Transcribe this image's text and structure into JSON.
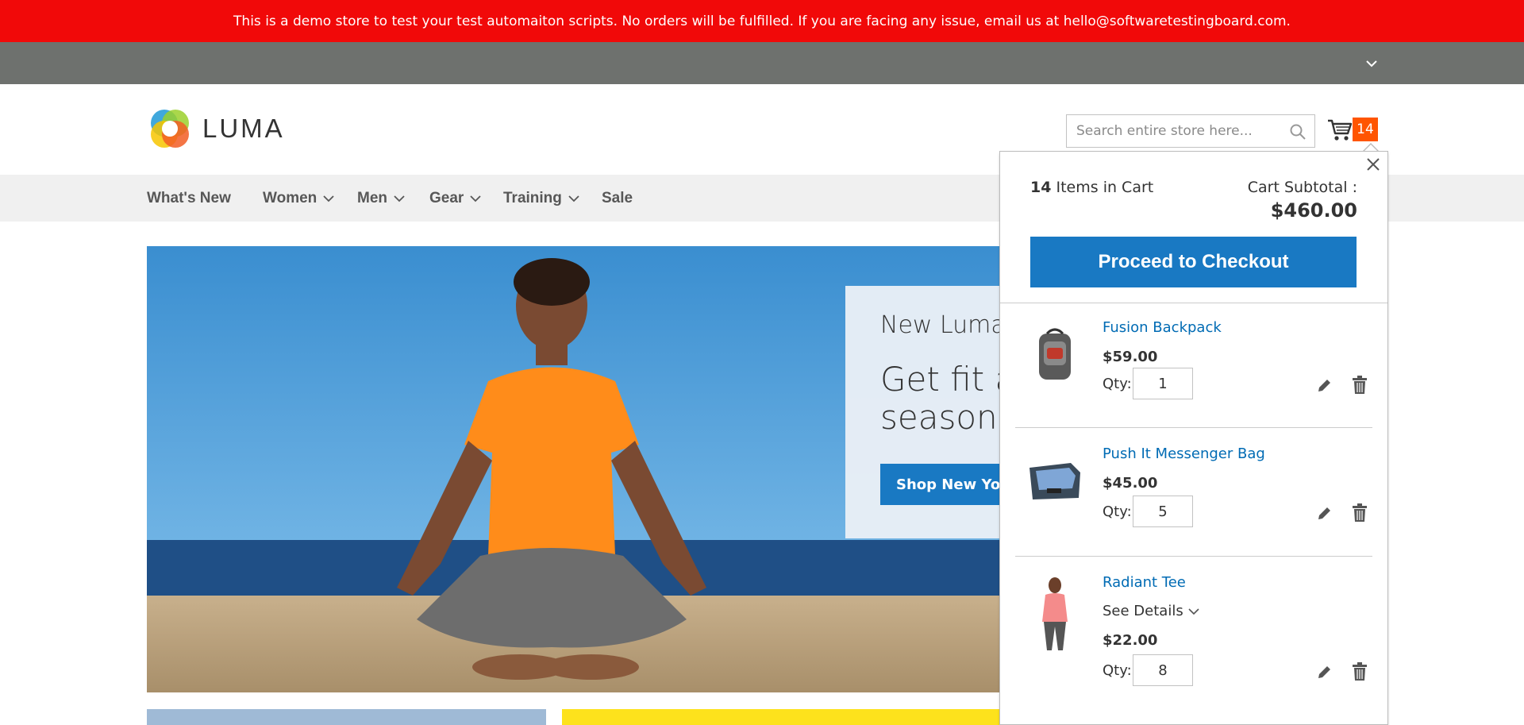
{
  "demo_notice": "This is a demo store to test your test automaiton scripts. No orders will be fulfilled. If you are facing any issue, email us at hello@softwaretestingboard.com.",
  "header": {
    "logo_text": "LUMA",
    "search_placeholder": "Search entire store here...",
    "cart_count": "14"
  },
  "nav": {
    "items": [
      {
        "label": "What's New",
        "has_submenu": false
      },
      {
        "label": "Women",
        "has_submenu": true
      },
      {
        "label": "Men",
        "has_submenu": true
      },
      {
        "label": "Gear",
        "has_submenu": true
      },
      {
        "label": "Training",
        "has_submenu": true
      },
      {
        "label": "Sale",
        "has_submenu": false
      }
    ]
  },
  "hero": {
    "kicker": "New Luma Y",
    "headline_line1": "Get fit ar",
    "headline_line2": "seasona",
    "button_label": "Shop New Yoga"
  },
  "minicart": {
    "count": "14",
    "count_suffix": "Items in Cart",
    "subtotal_label": "Cart Subtotal :",
    "subtotal": "$460.00",
    "checkout_label": "Proceed to Checkout",
    "qty_label": "Qty:",
    "see_details_label": "See Details",
    "items": [
      {
        "name": "Fusion Backpack",
        "price": "$59.00",
        "qty": "1"
      },
      {
        "name": "Push It Messenger Bag",
        "price": "$45.00",
        "qty": "5"
      },
      {
        "name": "Radiant Tee",
        "price": "$22.00",
        "qty": "8"
      }
    ]
  },
  "colors": {
    "demo_bar": "#f10909",
    "panel_bar": "#6e716e",
    "accent_blue": "#1979c3",
    "link_blue": "#006bb4",
    "cart_badge": "#ff5501",
    "nav_bg": "#f0f0f0"
  }
}
